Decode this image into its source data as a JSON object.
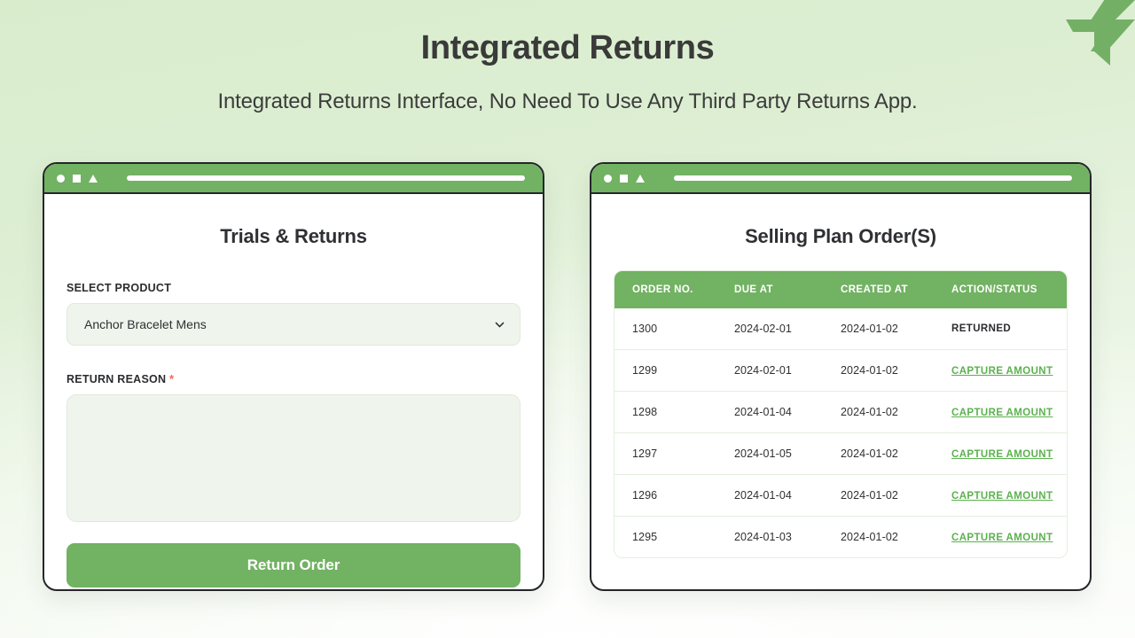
{
  "header": {
    "title": "Integrated Returns",
    "subtitle": "Integrated Returns Interface, No Need To Use Any Third Party Returns App."
  },
  "brand": {
    "logo_icon": "flight-arrow-logo-icon",
    "accent_green": "#72b263",
    "link_green": "#5cb14f",
    "title_color": "#3a3a3a",
    "background_green": "#d9edcd"
  },
  "left_window": {
    "chrome": {
      "circle_icon": "circle-icon",
      "square_icon": "square-icon",
      "triangle_icon": "triangle-icon",
      "address_bar_icon": "address-bar"
    },
    "heading": "Trials & Returns",
    "product_field": {
      "label": "SELECT PRODUCT",
      "value": "Anchor Bracelet Mens",
      "chevron_icon": "chevron-down-icon"
    },
    "reason_field": {
      "label": "RETURN REASON",
      "required_marker": "*",
      "value": "",
      "placeholder": ""
    },
    "submit_button": "Return Order"
  },
  "right_window": {
    "chrome": {
      "circle_icon": "circle-icon",
      "square_icon": "square-icon",
      "triangle_icon": "triangle-icon",
      "address_bar_icon": "address-bar"
    },
    "heading": "Selling Plan Order(S)",
    "table": {
      "columns": [
        "ORDER NO.",
        "DUE AT",
        "CREATED AT",
        "ACTION/STATUS"
      ],
      "rows": [
        {
          "order_no": "1300",
          "due_at": "2024-02-01",
          "created_at": "2024-01-02",
          "action": "RETURNED",
          "is_link": false
        },
        {
          "order_no": "1299",
          "due_at": "2024-02-01",
          "created_at": "2024-01-02",
          "action": "CAPTURE AMOUNT",
          "is_link": true
        },
        {
          "order_no": "1298",
          "due_at": "2024-01-04",
          "created_at": "2024-01-02",
          "action": "CAPTURE AMOUNT",
          "is_link": true
        },
        {
          "order_no": "1297",
          "due_at": "2024-01-05",
          "created_at": "2024-01-02",
          "action": "CAPTURE AMOUNT",
          "is_link": true
        },
        {
          "order_no": "1296",
          "due_at": "2024-01-04",
          "created_at": "2024-01-02",
          "action": "CAPTURE AMOUNT",
          "is_link": true
        },
        {
          "order_no": "1295",
          "due_at": "2024-01-03",
          "created_at": "2024-01-02",
          "action": "CAPTURE AMOUNT",
          "is_link": true
        }
      ]
    }
  }
}
